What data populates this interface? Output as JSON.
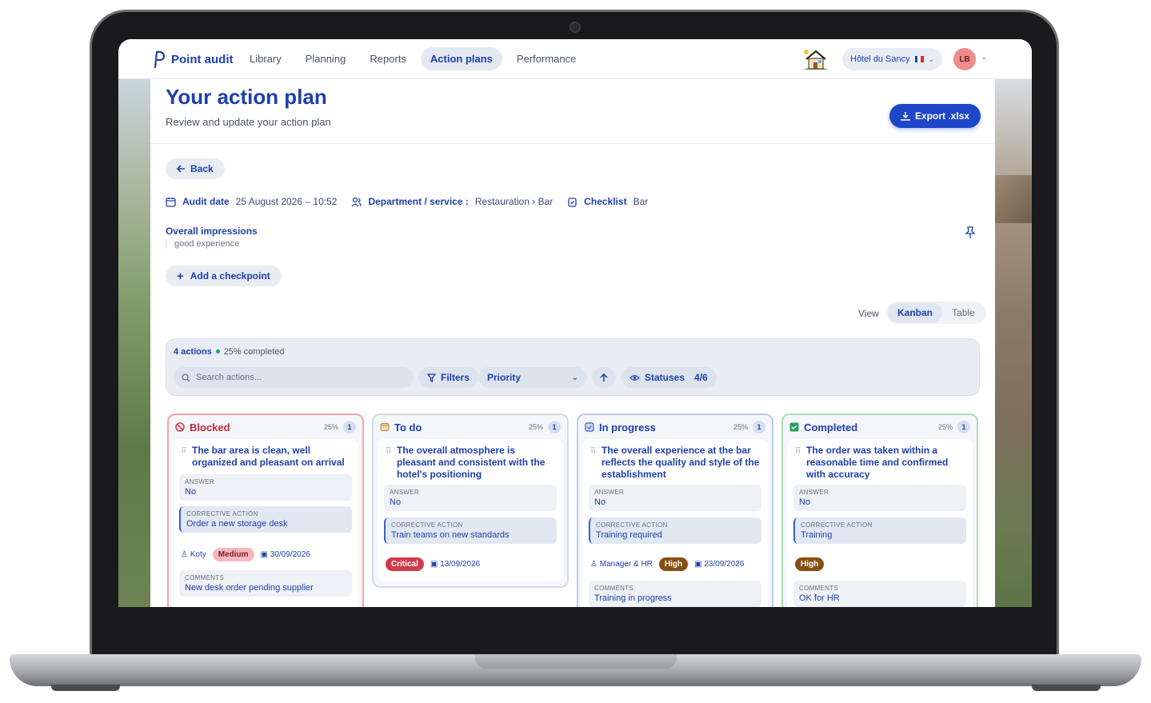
{
  "nav": {
    "logo": "Point audit",
    "links": [
      "Library",
      "Planning",
      "Reports",
      "Action plans",
      "Performance"
    ],
    "active": "Action plans",
    "hotel": "Hôtel du Sancy",
    "avatar": "LB"
  },
  "page": {
    "title": "Your action plan",
    "subtitle": "Review and update your action plan",
    "export_label": "Export .xlsx",
    "back_label": "Back",
    "audit_date_label": "Audit date",
    "audit_date_value": "25 August 2026 – 10:52",
    "department_label": "Department / service :",
    "department_value": "Restauration › Bar",
    "checklist_label": "Checklist",
    "checklist_value": "Bar",
    "impressions_label": "Overall impressions",
    "impressions_value": "good experience",
    "add_checkpoint_label": "Add a checkpoint",
    "view_label": "View",
    "view_options": [
      "Kanban",
      "Table"
    ]
  },
  "toolbar": {
    "count": "4 actions",
    "completed": "25% completed",
    "search_placeholder": "Search actions...",
    "filters_label": "Filters",
    "priority_label": "Priority",
    "statuses_label": "Statuses",
    "statuses_count": "4/6"
  },
  "columns": [
    {
      "title": "Blocked",
      "pct": "25%",
      "count": "1",
      "card": {
        "title": "The bar area is clean, well organized and pleasant on arrival",
        "answer_label": "ANSWER",
        "answer": "No",
        "action_label": "CORRECTIVE ACTION",
        "action": "Order a new storage desk",
        "assignee": "Koty",
        "priority": "Medium",
        "due": "30/09/2026",
        "comments_label": "COMMENTS",
        "comments": "New desk order pending supplier"
      }
    },
    {
      "title": "To do",
      "pct": "25%",
      "count": "1",
      "card": {
        "title": "The overall atmosphere is pleasant and consistent with the hotel's positioning",
        "answer_label": "ANSWER",
        "answer": "No",
        "action_label": "CORRECTIVE ACTION",
        "action": "Train teams on new standards",
        "priority": "Critical",
        "due": "13/09/2026"
      }
    },
    {
      "title": "In progress",
      "pct": "25%",
      "count": "1",
      "card": {
        "title": "The overall experience at the bar reflects the quality and style of the establishment",
        "answer_label": "ANSWER",
        "answer": "No",
        "action_label": "CORRECTIVE ACTION",
        "action": "Training required",
        "assignee": "Manager & HR",
        "priority": "High",
        "due": "23/09/2026",
        "comments_label": "COMMENTS",
        "comments": "Training in progress"
      }
    },
    {
      "title": "Completed",
      "pct": "25%",
      "count": "1",
      "card": {
        "title": "The order was taken within a reasonable time and confirmed with accuracy",
        "answer_label": "ANSWER",
        "answer": "No",
        "action_label": "CORRECTIVE ACTION",
        "action": "Training",
        "priority": "High",
        "comments_label": "COMMENTS",
        "comments": "OK for HR"
      }
    }
  ]
}
